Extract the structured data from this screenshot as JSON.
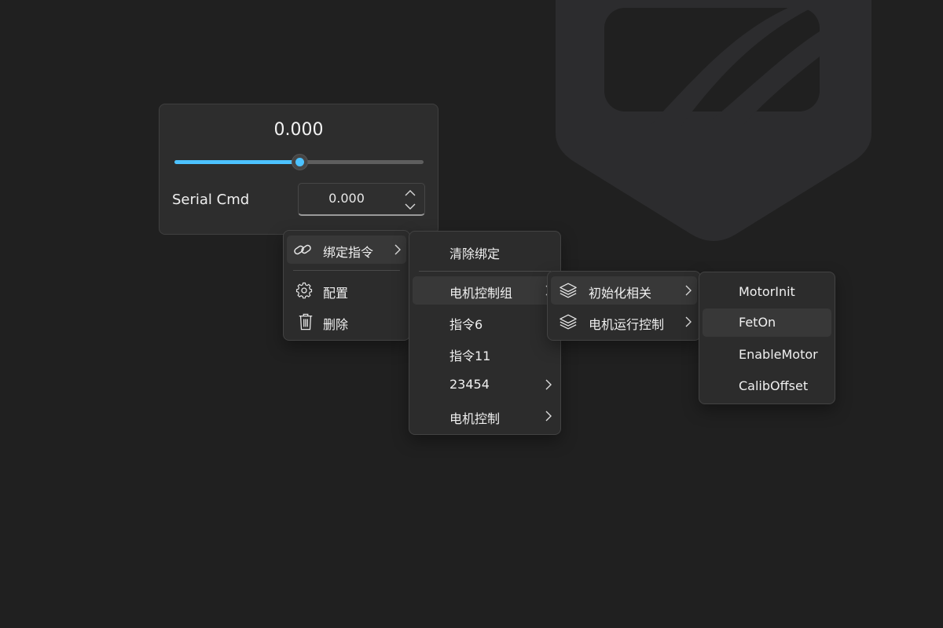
{
  "widget": {
    "display_value": "0.000",
    "slider_value": 0.5,
    "field_label": "Serial Cmd",
    "input_value": "0.000"
  },
  "colors": {
    "accent": "#4cc2ff",
    "background": "#202020",
    "surface": "#2d2d2d",
    "menu": "#2c2c2c",
    "hover": "#383838"
  },
  "menu_main": {
    "items": [
      {
        "label": "绑定指令",
        "icon": "link-icon",
        "has_submenu": true
      },
      {
        "label": "配置",
        "icon": "gear-icon",
        "has_submenu": false
      },
      {
        "label": "删除",
        "icon": "trash-icon",
        "has_submenu": false
      }
    ]
  },
  "menu_bind": {
    "items": [
      {
        "label": "清除绑定",
        "has_submenu": false
      },
      {
        "label": "电机控制组",
        "has_submenu": true
      },
      {
        "label": "指令6",
        "has_submenu": false
      },
      {
        "label": "指令11",
        "has_submenu": false
      },
      {
        "label": "23454",
        "has_submenu": true
      },
      {
        "label": "电机控制",
        "has_submenu": true
      }
    ]
  },
  "menu_group": {
    "items": [
      {
        "label": "初始化相关",
        "icon": "layers-icon",
        "has_submenu": true
      },
      {
        "label": "电机运行控制",
        "icon": "layers-icon",
        "has_submenu": true
      }
    ]
  },
  "menu_commands": {
    "items": [
      {
        "label": "MotorInit"
      },
      {
        "label": "FetOn"
      },
      {
        "label": "EnableMotor"
      },
      {
        "label": "CalibOffset"
      }
    ]
  }
}
